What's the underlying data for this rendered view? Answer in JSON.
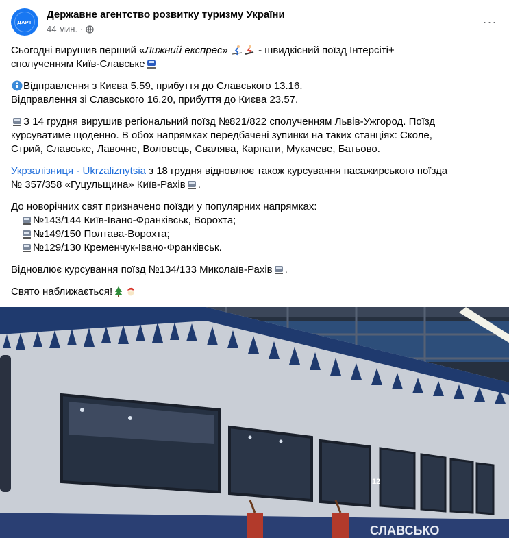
{
  "header": {
    "page_name": "Державне агентство розвитку туризму України",
    "avatar_text": "ДАРТ",
    "time": "44 мин.",
    "separator": "·",
    "more": "···"
  },
  "post": {
    "p1_a": "Сьогодні вирушив перший «",
    "p1_italic": "Лижний експрес",
    "p1_b": "» ",
    "p1_c": " - швидкісний поїзд Інтерсіті+",
    "p1_d": "сполученням Київ-Славське",
    "p2_line1": "Відправлення з Києва 5.59, прибуття до Славського 13.16.",
    "p2_line2": "Відправлення зі Славського 16.20, прибуття до Києва 23.57.",
    "p3_line1": "З 14 грудня вирушив регіональний поїзд №821/822 сполученням Львів-Ужгород.  Поїзд",
    "p3_line2": "курсуватиме щоденно. В обох напрямках передбачені зупинки на таких станціях: Сколе,",
    "p3_line3": "Стрий, Славське, Лавочне, Воловець, Свалява, Карпати, Мукачеве, Батьово.",
    "p4_link": "Укрзалізниця - Ukrzaliznytsia",
    "p4_a": " з 18 грудня відновлює також курсування пасажирського поїзда",
    "p4_b": "№ 357/358 «Гуцульщина» Київ-Рахів",
    "p4_c": ".",
    "p5_intro": "До новорічних свят призначено поїзди у популярних напрямках:",
    "p5_item1": "№143/144 Київ-Івано-Франківськ, Ворохта;",
    "p5_item2": "№149/150 Полтава-Ворохта;",
    "p5_item3": "№129/130 Кременчук-Івано-Франківськ.",
    "p6_a": "Відновлює курсування поїзд №134/133 Миколаїв-Рахів",
    "p6_b": ".",
    "p7": "Свято наближається!"
  },
  "photo": {
    "car_sign": "СЛАВСЬКО",
    "car_number": "12"
  },
  "colors": {
    "link": "#216fdb",
    "meta_text": "#65676b",
    "avatar_bg": "#1877f2",
    "train_body": "#c9ced6",
    "train_stripe": "#1f3a6e"
  },
  "icons": [
    "globe-icon",
    "more-icon",
    "skier-icon",
    "snowboarder-icon",
    "train-icon",
    "info-icon",
    "tree-icon",
    "santa-icon"
  ]
}
